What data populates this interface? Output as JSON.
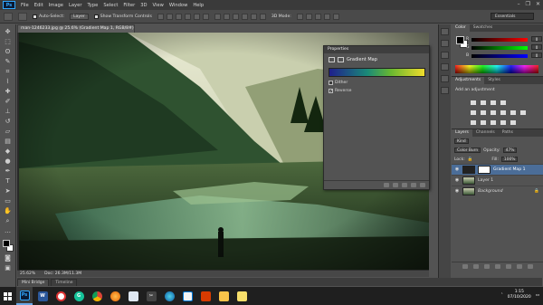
{
  "app": {
    "logo": "Ps",
    "menu": [
      "File",
      "Edit",
      "Image",
      "Layer",
      "Type",
      "Select",
      "Filter",
      "3D",
      "View",
      "Window",
      "Help"
    ],
    "window_controls": [
      "–",
      "❐",
      "✕"
    ]
  },
  "options_bar": {
    "auto_select_label": "Auto-Select:",
    "layer_select": "Layer",
    "transform_label": "Show Transform Controls",
    "mode_3d_label": "3D Mode:",
    "workspace": "Essentials"
  },
  "document": {
    "tab_title": "man-1246233.jpg @ 25.6% (Gradient Map 1, RGB/8#) *",
    "zoom": "25.62%",
    "doc_size": "Doc: 26.3M/11.3M"
  },
  "bottom_tabs": [
    "Mini Bridge",
    "Timeline"
  ],
  "properties": {
    "header": "Properties",
    "title": "Gradient Map",
    "dither_label": "Dither",
    "dither_checked": false,
    "reverse_label": "Reverse",
    "reverse_checked": true
  },
  "color_panel": {
    "tabs": [
      "Color",
      "Swatches"
    ],
    "sliders": [
      {
        "label": "R",
        "value": "0"
      },
      {
        "label": "G",
        "value": "0"
      },
      {
        "label": "B",
        "value": "0"
      }
    ]
  },
  "adjustments_panel": {
    "tabs": [
      "Adjustments",
      "Styles"
    ],
    "add_label": "Add an adjustment"
  },
  "layers_panel": {
    "tabs": [
      "Layers",
      "Channels",
      "Paths"
    ],
    "kind_label": "Kind",
    "blend_mode": "Color Burn",
    "opacity_label": "Opacity:",
    "opacity_value": "47%",
    "lock_label": "Lock:",
    "fill_label": "Fill:",
    "fill_value": "100%",
    "layers": [
      {
        "name": "Gradient Map 1",
        "selected": true
      },
      {
        "name": "Layer 1",
        "selected": false
      },
      {
        "name": "Background",
        "selected": false
      }
    ]
  },
  "taskbar": {
    "apps": [
      "photoshop-icon",
      "word-icon",
      "chrome-ext-icon",
      "grammarly-icon",
      "chrome-icon",
      "firefox-icon",
      "notepad-icon",
      "snipping-icon",
      "edge-icon",
      "paint-icon",
      "office-icon",
      "folder-icon",
      "sticky-notes-icon"
    ],
    "time": "1:15",
    "date": "07/10/2020"
  }
}
